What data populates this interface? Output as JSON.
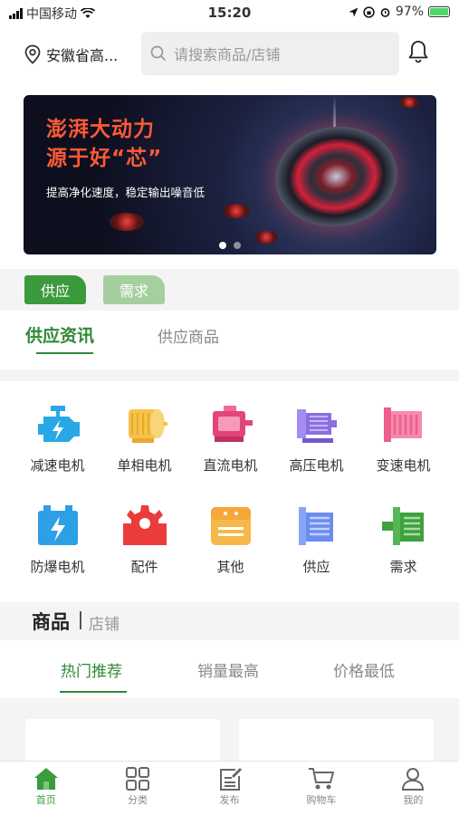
{
  "status_bar": {
    "carrier": "中国移动",
    "time": "15:20",
    "battery": "97%"
  },
  "header": {
    "location": "安徽省高...",
    "search_placeholder": "请搜索商品/店铺"
  },
  "banner": {
    "title_line1": "澎湃大动力",
    "title_line2": "源于好“芯”",
    "subtitle": "提高净化速度，稳定输出噪音低",
    "slide_count": 2,
    "active_slide": 1
  },
  "supply_demand": {
    "supply": "供应",
    "demand": "需求"
  },
  "info_tabs": {
    "active": "供应资讯",
    "inactive": "供应商品"
  },
  "categories": [
    {
      "label": "减速电机",
      "icon": "engine-icon",
      "color": "#29a8e6"
    },
    {
      "label": "单相电机",
      "icon": "motor-icon",
      "color": "#f5b731"
    },
    {
      "label": "直流电机",
      "icon": "motor-icon",
      "color": "#e2457a"
    },
    {
      "label": "高压电机",
      "icon": "motor-icon",
      "color": "#8b6fe0"
    },
    {
      "label": "变速电机",
      "icon": "motor-icon",
      "color": "#ef5e8a"
    },
    {
      "label": "防爆电机",
      "icon": "battery-icon",
      "color": "#2c9fe6"
    },
    {
      "label": "配件",
      "icon": "gear-icon",
      "color": "#ec3b3b"
    },
    {
      "label": "其他",
      "icon": "box-icon",
      "color": "#f4a73a"
    },
    {
      "label": "供应",
      "icon": "supply-icon",
      "color": "#6b8cf0"
    },
    {
      "label": "需求",
      "icon": "demand-icon",
      "color": "#3ea13e"
    }
  ],
  "products": {
    "title": "商品",
    "shops": "店铺",
    "sort_tabs": [
      "热门推荐",
      "销量最高",
      "价格最低"
    ]
  },
  "bottom_nav": [
    {
      "label": "首页",
      "icon": "home-icon",
      "active": true
    },
    {
      "label": "分类",
      "icon": "grid-icon",
      "active": false
    },
    {
      "label": "发布",
      "icon": "edit-icon",
      "active": false
    },
    {
      "label": "购物车",
      "icon": "cart-icon",
      "active": false
    },
    {
      "label": "我的",
      "icon": "user-icon",
      "active": false
    }
  ],
  "colors": {
    "accent": "#2f8a35",
    "banner_title": "#ff5a36"
  }
}
